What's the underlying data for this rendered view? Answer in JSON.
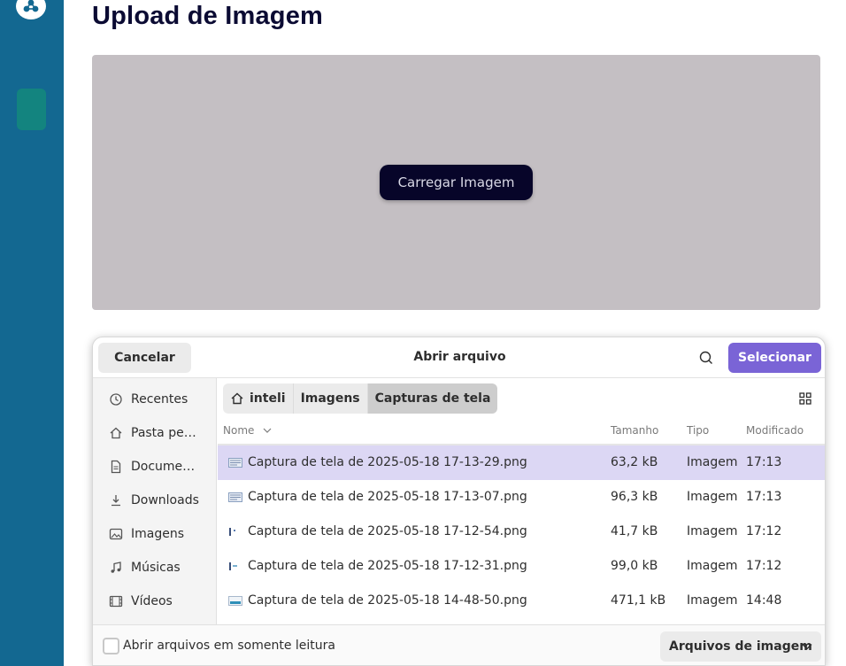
{
  "page": {
    "title": "Upload de Imagem",
    "upload_button": "Carregar Imagem"
  },
  "dialog": {
    "title": "Abrir arquivo",
    "cancel_label": "Cancelar",
    "select_label": "Selecionar",
    "places": [
      {
        "label": "Recentes",
        "icon": "clock-icon"
      },
      {
        "label": "Pasta pe…",
        "icon": "home-icon"
      },
      {
        "label": "Docume…",
        "icon": "document-icon"
      },
      {
        "label": "Downloads",
        "icon": "download-icon"
      },
      {
        "label": "Imagens",
        "icon": "image-icon"
      },
      {
        "label": "Músicas",
        "icon": "music-icon"
      },
      {
        "label": "Vídeos",
        "icon": "video-icon"
      }
    ],
    "path": [
      "inteli",
      "Imagens",
      "Capturas de tela"
    ],
    "columns": {
      "name": "Nome",
      "size": "Tamanho",
      "type": "Tipo",
      "modified": "Modificado"
    },
    "files": [
      {
        "name": "Captura de tela de 2025-05-18 17-13-29.png",
        "size": "63,2 kB",
        "type": "Imagem",
        "modified": "17:13",
        "selected": true
      },
      {
        "name": "Captura de tela de 2025-05-18 17-13-07.png",
        "size": "96,3 kB",
        "type": "Imagem",
        "modified": "17:13",
        "selected": false
      },
      {
        "name": "Captura de tela de 2025-05-18 17-12-54.png",
        "size": "41,7 kB",
        "type": "Imagem",
        "modified": "17:12",
        "selected": false
      },
      {
        "name": "Captura de tela de 2025-05-18 17-12-31.png",
        "size": "99,0 kB",
        "type": "Imagem",
        "modified": "17:12",
        "selected": false
      },
      {
        "name": "Captura de tela de 2025-05-18 14-48-50.png",
        "size": "471,1 kB",
        "type": "Imagem",
        "modified": "14:48",
        "selected": false
      }
    ],
    "readonly_label": "Abrir arquivos em somente leitura",
    "filter_label": "Arquivos de imagem"
  },
  "colors": {
    "sidebar": "#136891",
    "accent": "#7a64d6",
    "selected_row": "#dcd7f4",
    "upload_button": "#070529"
  }
}
